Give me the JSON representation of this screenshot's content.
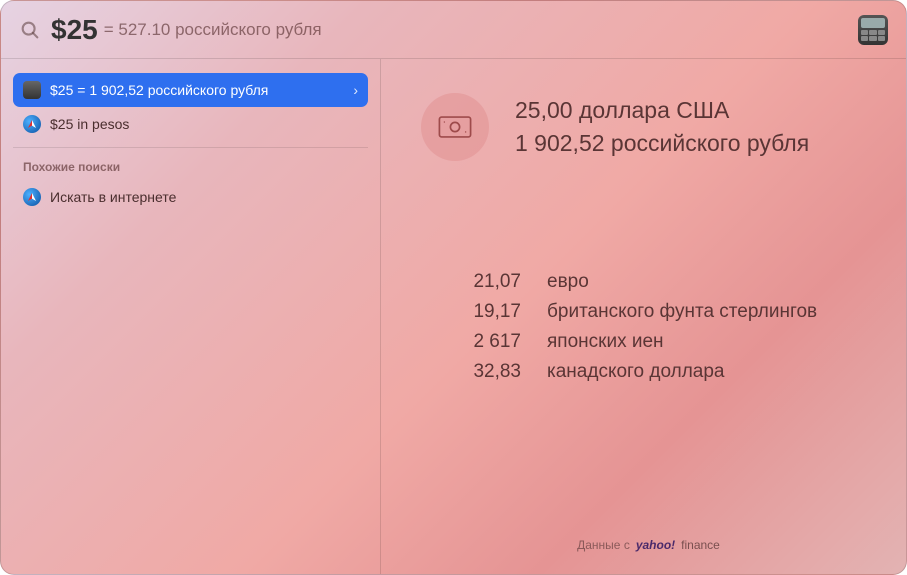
{
  "search": {
    "query": "$25",
    "inline_result": "= 527.10 российского рубля"
  },
  "sidebar": {
    "results": [
      {
        "label": "$25 = 1 902,52 российского рубля"
      },
      {
        "label": "$25 in pesos"
      }
    ],
    "section_header": "Похожие поиски",
    "web_search_label": "Искать в интернете"
  },
  "detail": {
    "primary_amount": "25,00 доллара США",
    "primary_converted": "1 902,52 российского рубля",
    "conversions": [
      {
        "amount": "21,07",
        "currency": "евро"
      },
      {
        "amount": "19,17",
        "currency": "британского фунта стерлингов"
      },
      {
        "amount": "2 617",
        "currency": "японских иен"
      },
      {
        "amount": "32,83",
        "currency": "канадского доллара"
      }
    ],
    "attribution_prefix": "Данные с",
    "attribution_brand": "yahoo!",
    "attribution_suffix": "finance"
  }
}
